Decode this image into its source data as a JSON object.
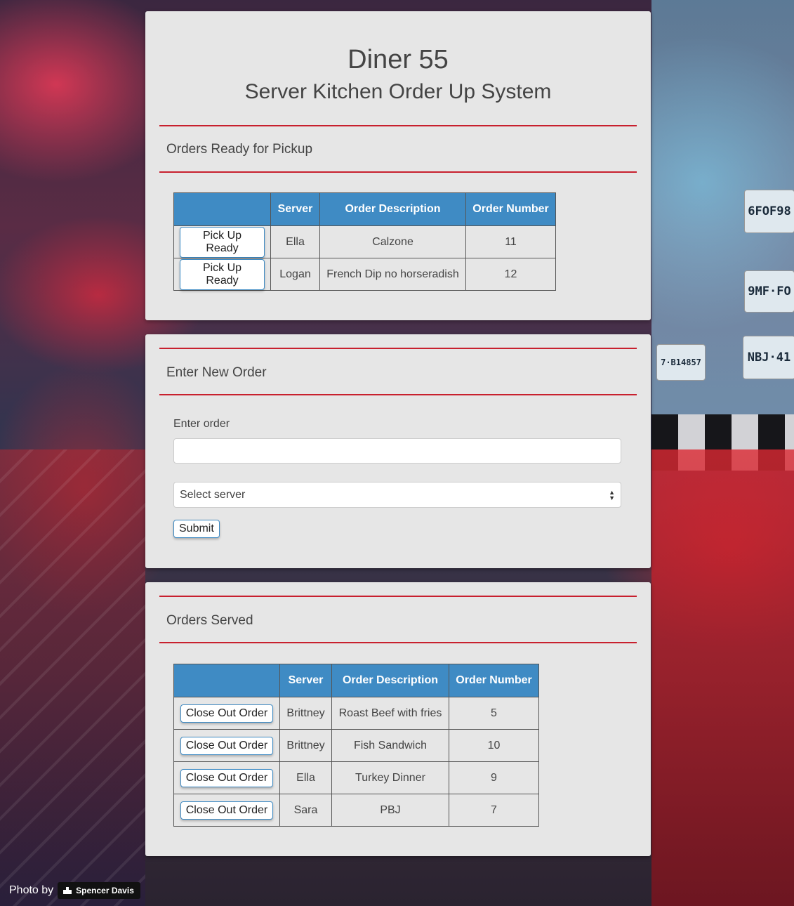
{
  "header": {
    "title": "Diner 55",
    "subtitle": "Server Kitchen Order Up System"
  },
  "pickup": {
    "heading": "Orders Ready for Pickup",
    "columns": [
      "",
      "Server",
      "Order Description",
      "Order Number"
    ],
    "rows": [
      {
        "action": "Pick Up Ready",
        "server": "Ella",
        "description": "Calzone",
        "number": "11"
      },
      {
        "action": "Pick Up Ready",
        "server": "Logan",
        "description": "French Dip no horseradish",
        "number": "12"
      }
    ]
  },
  "new_order": {
    "heading": "Enter New Order",
    "label": "Enter order",
    "input_value": "",
    "select_value": "Select server",
    "submit_label": "Submit"
  },
  "served": {
    "heading": "Orders Served",
    "columns": [
      "",
      "Server",
      "Order Description",
      "Order Number"
    ],
    "rows": [
      {
        "action": "Close Out Order",
        "server": "Brittney",
        "description": "Roast Beef with fries",
        "number": "5"
      },
      {
        "action": "Close Out Order",
        "server": "Brittney",
        "description": "Fish Sandwich",
        "number": "10"
      },
      {
        "action": "Close Out Order",
        "server": "Ella",
        "description": "Turkey Dinner",
        "number": "9"
      },
      {
        "action": "Close Out Order",
        "server": "Sara",
        "description": "PBJ",
        "number": "7"
      }
    ]
  },
  "background_plates": [
    {
      "text": "6FOF98"
    },
    {
      "text": "9MF·FO"
    },
    {
      "text": "7·B14857"
    },
    {
      "text": "NBJ·41"
    }
  ],
  "credit": {
    "prefix": "Photo by",
    "author": "Spencer Davis"
  },
  "colors": {
    "accent": "#3f8bc4",
    "divider": "#c8202e",
    "card": "#e6e6e6"
  }
}
